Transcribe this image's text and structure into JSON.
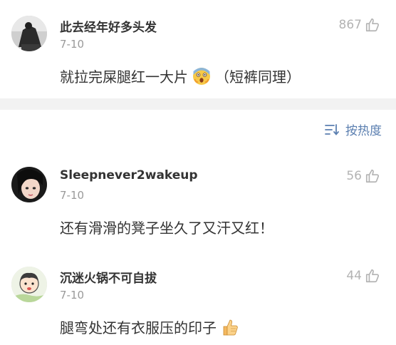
{
  "comments": [
    {
      "username": "此去经年好多头发",
      "date": "7-10",
      "likes": "867",
      "text": "就拉完屎腿红一大片",
      "emoji": "scared-face-emoji",
      "text_suffix": "（短裤同理）"
    },
    {
      "username": "Sleepnever2wakeup",
      "date": "7-10",
      "likes": "56",
      "text": "还有滑滑的凳子坐久了又汗又红！"
    },
    {
      "username": "沉迷火锅不可自拔",
      "date": "7-10",
      "likes": "44",
      "text": "腿弯处还有衣服压的印子",
      "emoji": "thumbs-up-emoji"
    }
  ],
  "sort": {
    "label": "按热度",
    "icon": "sort-icon"
  },
  "colors": {
    "username": "#333333",
    "date": "#9a9a9a",
    "like": "#b3b3b3",
    "sort_accent": "#5b7fb0",
    "divider": "#f2f2f2"
  }
}
